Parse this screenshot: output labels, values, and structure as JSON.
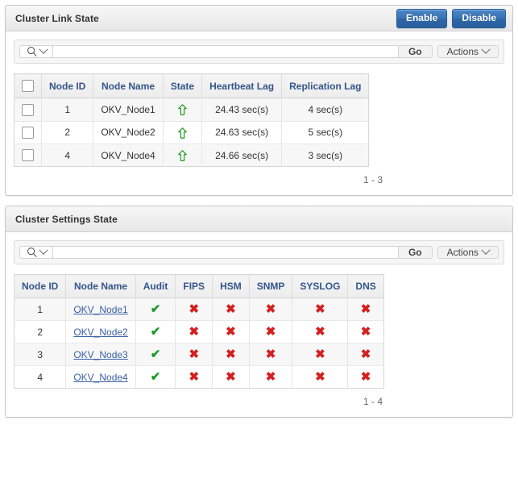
{
  "regions": [
    {
      "id": "cluster-link-state",
      "title": "Cluster Link State",
      "buttons": [
        {
          "name": "enable-button",
          "label": "Enable"
        },
        {
          "name": "disable-button",
          "label": "Disable"
        }
      ],
      "toolbar": {
        "search_placeholder": "",
        "search_value": "",
        "search_icon": "search-icon",
        "go_label": "Go",
        "actions_label": "Actions"
      },
      "table": {
        "columns": [
          "",
          "Node ID",
          "Node Name",
          "State",
          "Heartbeat Lag",
          "Replication Lag"
        ],
        "rows": [
          {
            "node_id": "1",
            "node_name": "OKV_Node1",
            "state_icon": "up-arrow-icon",
            "heartbeat_lag": "24.43 sec(s)",
            "replication_lag": "4 sec(s)"
          },
          {
            "node_id": "2",
            "node_name": "OKV_Node2",
            "state_icon": "up-arrow-icon",
            "heartbeat_lag": "24.63 sec(s)",
            "replication_lag": "5 sec(s)"
          },
          {
            "node_id": "4",
            "node_name": "OKV_Node4",
            "state_icon": "up-arrow-icon",
            "heartbeat_lag": "24.66 sec(s)",
            "replication_lag": "3 sec(s)"
          }
        ]
      },
      "pagination": "1 - 3"
    },
    {
      "id": "cluster-settings-state",
      "title": "Cluster Settings State",
      "buttons": [],
      "toolbar": {
        "search_placeholder": "",
        "search_value": "",
        "search_icon": "search-icon",
        "go_label": "Go",
        "actions_label": "Actions"
      },
      "table": {
        "columns": [
          "Node ID",
          "Node Name",
          "Audit",
          "FIPS",
          "HSM",
          "SNMP",
          "SYSLOG",
          "DNS"
        ],
        "rows": [
          {
            "node_id": "1",
            "node_name": "OKV_Node1",
            "audit": "check",
            "fips": "cross",
            "hsm": "cross",
            "snmp": "cross",
            "syslog": "cross",
            "dns": "cross"
          },
          {
            "node_id": "2",
            "node_name": "OKV_Node2",
            "audit": "check",
            "fips": "cross",
            "hsm": "cross",
            "snmp": "cross",
            "syslog": "cross",
            "dns": "cross"
          },
          {
            "node_id": "3",
            "node_name": "OKV_Node3",
            "audit": "check",
            "fips": "cross",
            "hsm": "cross",
            "snmp": "cross",
            "syslog": "cross",
            "dns": "cross"
          },
          {
            "node_id": "4",
            "node_name": "OKV_Node4",
            "audit": "check",
            "fips": "cross",
            "hsm": "cross",
            "snmp": "cross",
            "syslog": "cross",
            "dns": "cross"
          }
        ]
      },
      "pagination": "1 - 4"
    }
  ],
  "glyphs": {
    "check": "✔",
    "cross": "✖"
  },
  "colors": {
    "button_blue": "#2a5f9e",
    "header_text": "#33558b",
    "link": "#3a5fa8",
    "check_green": "#1a9b27",
    "cross_red": "#d42020",
    "state_arrow_green": "#2aa02a"
  }
}
